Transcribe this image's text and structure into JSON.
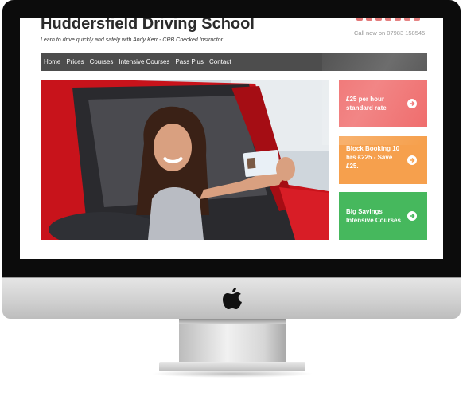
{
  "site": {
    "title": "Huddersfield Driving School",
    "tagline": "Learn to drive quickly and safely with Andy Kerr - CRB Checked Instructor",
    "phone": "Call now on 07983 158545"
  },
  "social_icons": [
    "twitter-icon",
    "facebook-icon",
    "instagram-icon",
    "linkedin-icon",
    "youtube-icon",
    "google-plus-icon",
    "pinterest-icon"
  ],
  "nav": {
    "items": [
      {
        "label": "Home",
        "active": true
      },
      {
        "label": "Prices"
      },
      {
        "label": "Courses"
      },
      {
        "label": "Intensive Courses"
      },
      {
        "label": "Pass Plus"
      },
      {
        "label": "Contact"
      }
    ]
  },
  "promos": [
    {
      "text": "£25 per hour standard rate",
      "color": "#ef6b6b"
    },
    {
      "text": "Block Booking 10 hrs £225 - Save £25.",
      "color": "#f6a04d"
    },
    {
      "text": "Big Savings Intensive Courses",
      "color": "#46b85d"
    }
  ],
  "colors": {
    "nav_bg": "#4d4d4d",
    "social": "#e06b6b"
  }
}
